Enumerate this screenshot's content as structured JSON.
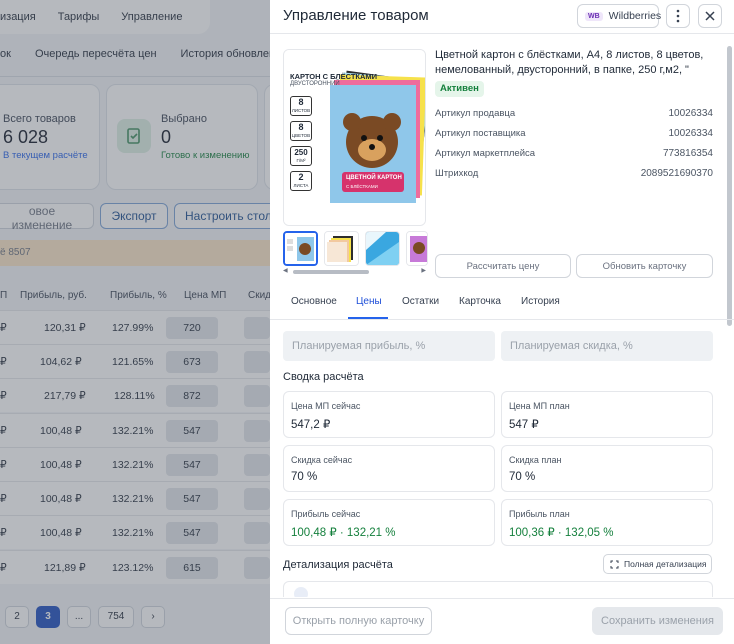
{
  "background": {
    "topnav": [
      "изация",
      "Тарифы",
      "Управление"
    ],
    "subnav": [
      "ок",
      "Очередь пересчёта цен",
      "История обновления"
    ],
    "stats": [
      {
        "label": "Всего товаров",
        "value": "6 028",
        "sub": "В текущем расчёте"
      },
      {
        "label": "Выбрано",
        "value": "0",
        "sub": "Готово к изменению"
      }
    ],
    "buttons": [
      "овое изменение",
      "Экспорт",
      "Настроить стол"
    ],
    "banner": "ё 8507",
    "columns": [
      "П",
      "Прибыль, руб.",
      "Прибыль, %",
      "Цена МП",
      "Скид"
    ],
    "rows": [
      [
        "₽",
        "120,31 ₽",
        "127.99%",
        "720"
      ],
      [
        "₽",
        "104,62 ₽",
        "121.65%",
        "673"
      ],
      [
        "₽",
        "217,79 ₽",
        "128.11%",
        "872"
      ],
      [
        "₽",
        "100,48 ₽",
        "132.21%",
        "547"
      ],
      [
        "₽",
        "100,48 ₽",
        "132.21%",
        "547"
      ],
      [
        "₽",
        "100,48 ₽",
        "132.21%",
        "547"
      ],
      [
        "₽",
        "100,48 ₽",
        "132.21%",
        "547"
      ],
      [
        "₽",
        "121,89 ₽",
        "123.12%",
        "615"
      ]
    ],
    "pager": [
      "2",
      "3",
      "...",
      "754",
      "›"
    ],
    "pager_current": "3"
  },
  "drawer": {
    "title": "Управление товаром",
    "marketplace_badge": "WB",
    "marketplace": "Wildberries",
    "more_icon": "more-vertical-icon",
    "close_icon": "close-icon",
    "product": {
      "title": "Цветной картон с блёстками, А4, 8 листов, 8 цветов, немелованный, двусторонний, в папке, 250 г,м2, \"",
      "status": "Активен",
      "fields": [
        {
          "label": "Артикул продавца",
          "value": "10026334"
        },
        {
          "label": "Артикул поставщика",
          "value": "10026334"
        },
        {
          "label": "Артикул маркетплейса",
          "value": "773816354"
        },
        {
          "label": "Штрихкод",
          "value": "2089521690370"
        }
      ],
      "image": {
        "heading": "КАРТОН С БЛЁСТКАМИ",
        "subheading": "ДВУСТОРОННИЙ",
        "badges": [
          {
            "num": "8",
            "word": "ЛИСТОВ"
          },
          {
            "num": "8",
            "word": "ЦВЕТОВ"
          },
          {
            "num": "250",
            "word": "Г/М²"
          },
          {
            "num": "2",
            "word": "ЛИСТА"
          }
        ],
        "cover_label": "ЦВЕТНОЙ КАРТОН",
        "cover_sub": "С БЛЁСТКАМИ"
      }
    },
    "actions": {
      "recalc": "Рассчитать цену",
      "update": "Обновить карточку"
    },
    "tabs": [
      "Основное",
      "Цены",
      "Остатки",
      "Карточка",
      "История"
    ],
    "active_tab": "Цены",
    "plan_profit_placeholder": "Планируемая прибыль, %",
    "plan_discount_placeholder": "Планируемая скидка, %",
    "summary_title": "Сводка расчёта",
    "summary": [
      {
        "label": "Цена МП сейчас",
        "value": "547,2 ₽"
      },
      {
        "label": "Цена МП план",
        "value": "547 ₽"
      },
      {
        "label": "Скидка сейчас",
        "value": "70 %"
      },
      {
        "label": "Скидка план",
        "value": "70 %"
      },
      {
        "label": "Прибыль сейчас",
        "value": "100,48 ₽ · 132,21 %"
      },
      {
        "label": "Прибыль план",
        "value": "100,36 ₽ · 132,05 %"
      }
    ],
    "detail_title": "Детализация расчёта",
    "detail_button": "Полная детализация",
    "footer": {
      "open_card": "Открыть полную карточку",
      "save": "Сохранить изменения"
    },
    "colors": {
      "accent": "#2563eb",
      "green": "#15803d",
      "status_bg": "#e5f5ea"
    }
  }
}
